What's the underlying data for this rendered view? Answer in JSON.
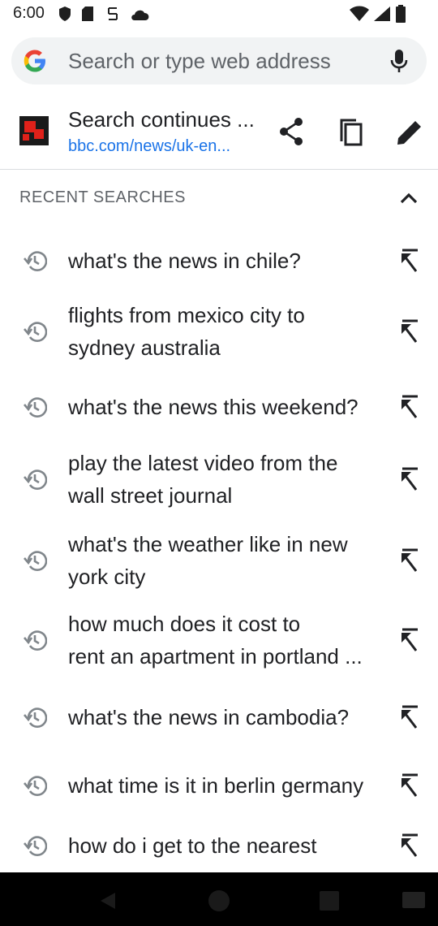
{
  "status_bar": {
    "time": "6:00"
  },
  "search": {
    "placeholder": "Search or type web address",
    "value": ""
  },
  "suggestion": {
    "title": "Search continues ...",
    "url": "bbc.com/news/uk-en..."
  },
  "recent": {
    "header": "RECENT SEARCHES",
    "items": [
      {
        "line1": "what's the news in chile?",
        "line2": ""
      },
      {
        "line1": "flights from mexico city to",
        "line2": "sydney australia"
      },
      {
        "line1": "what's the news this weekend?",
        "line2": ""
      },
      {
        "line1": "play the latest video from the",
        "line2": "wall street journal"
      },
      {
        "line1": "what's the weather like in new",
        "line2": "york city"
      },
      {
        "line1": "how much does it cost to",
        "line2": "rent an apartment in portland ..."
      },
      {
        "line1": "what's the news in cambodia?",
        "line2": ""
      },
      {
        "line1": "what time is it in berlin germany",
        "line2": ""
      },
      {
        "line1": "how do i get to the nearest",
        "line2": ""
      }
    ]
  },
  "colors": {
    "accent": "#1a73e8",
    "text": "#202124",
    "secondary": "#5f6368",
    "searchbar_bg": "#f1f3f4"
  }
}
